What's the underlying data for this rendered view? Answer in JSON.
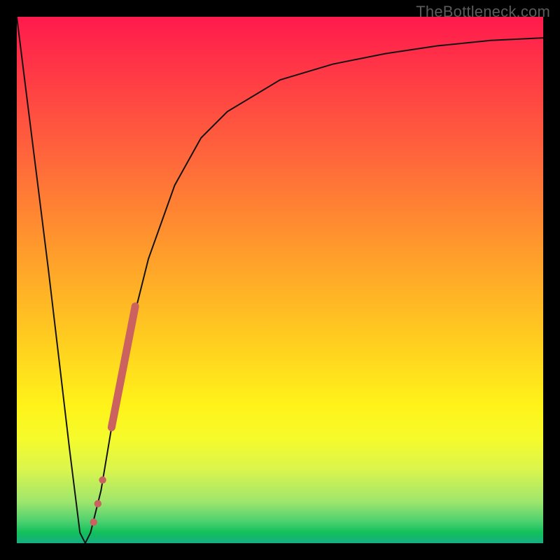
{
  "watermark": "TheBottleneck.com",
  "colors": {
    "frame": "#000000",
    "curve": "#141414",
    "accent_segment": "#cb6260",
    "accent_dot": "#cb6260"
  },
  "chart_data": {
    "type": "line",
    "title": "",
    "xlabel": "",
    "ylabel": "",
    "x_range": [
      0,
      100
    ],
    "y_range": [
      0,
      100
    ],
    "series": [
      {
        "name": "bottleneck-curve",
        "x": [
          0,
          2,
          4,
          6,
          8,
          10,
          12,
          13,
          14,
          16,
          18,
          20,
          22,
          25,
          30,
          35,
          40,
          50,
          60,
          70,
          80,
          90,
          100
        ],
        "y": [
          100,
          84,
          68,
          52,
          35,
          18,
          2,
          0,
          2,
          10,
          22,
          33,
          42,
          54,
          68,
          77,
          82,
          88,
          91,
          93,
          94.5,
          95.5,
          96
        ]
      }
    ],
    "highlight_segment": {
      "name": "accent-segment",
      "x": [
        18,
        22.5
      ],
      "y": [
        22,
        45
      ]
    },
    "highlight_dots": {
      "name": "accent-dots",
      "points": [
        {
          "x": 16.3,
          "y": 12
        },
        {
          "x": 15.4,
          "y": 7.5
        },
        {
          "x": 14.6,
          "y": 4
        }
      ]
    }
  }
}
